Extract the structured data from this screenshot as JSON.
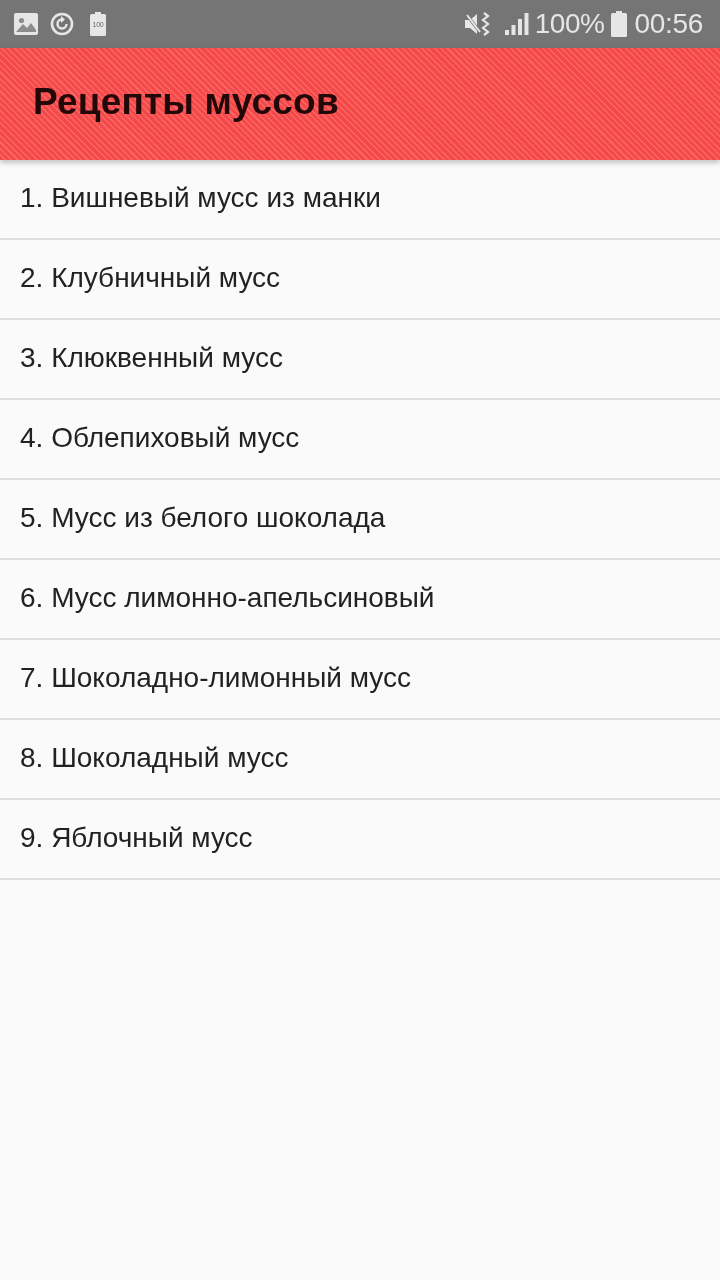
{
  "status_bar": {
    "notification_badge": "100",
    "battery_percent": "100%",
    "time": "00:56"
  },
  "app_bar": {
    "title": "Рецепты муссов"
  },
  "recipes": [
    {
      "label": "1. Вишневый мусс из манки"
    },
    {
      "label": "2. Клубничный мусс"
    },
    {
      "label": "3. Клюквенный мусс"
    },
    {
      "label": "4. Облепиховый мусс"
    },
    {
      "label": "5. Мусс из белого шоколада"
    },
    {
      "label": "6. Мусс лимонно-апельсиновый"
    },
    {
      "label": "7. Шоколадно-лимонный мусс"
    },
    {
      "label": "8. Шоколадный мусс"
    },
    {
      "label": "9. Яблочный мусс"
    }
  ]
}
